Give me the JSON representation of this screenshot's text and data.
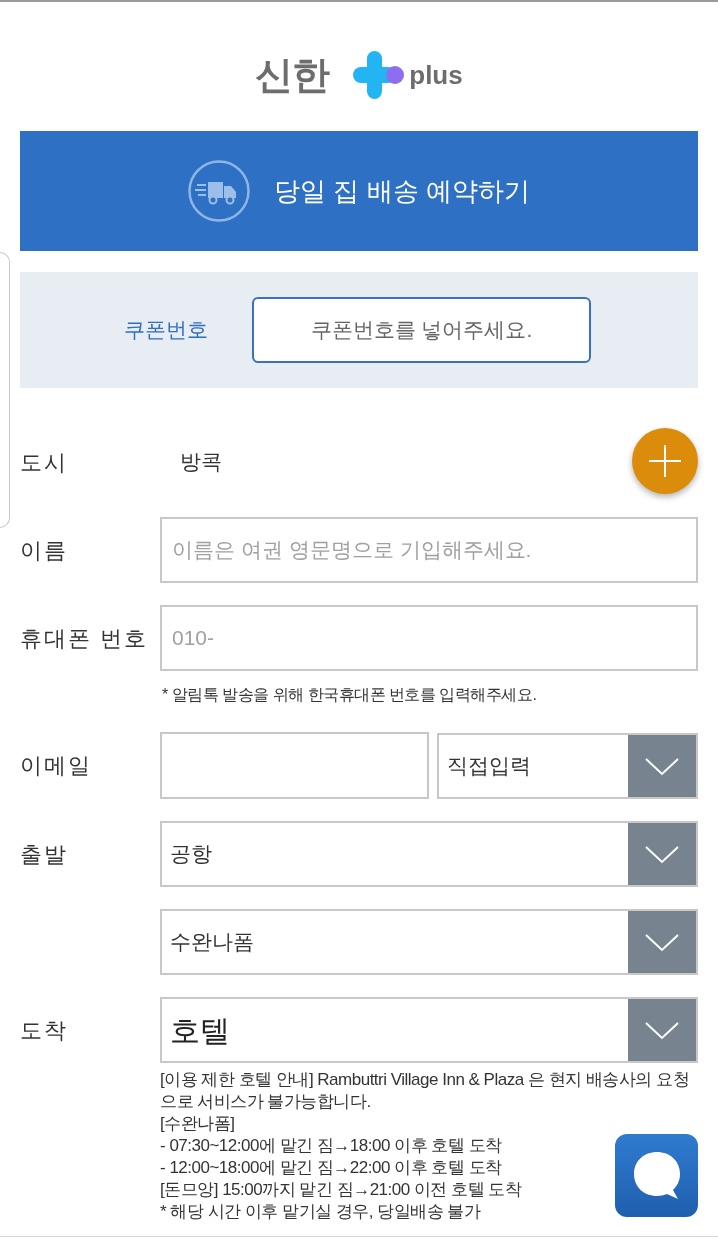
{
  "logo": {
    "name": "신한",
    "suffix": "plus"
  },
  "banner": {
    "title": "당일 집 배송 예약하기"
  },
  "coupon": {
    "label": "쿠폰번호",
    "placeholder": "쿠폰번호를 넣어주세요."
  },
  "rows": [
    {
      "kind": "static",
      "label": "도시",
      "value": "방콕"
    },
    {
      "kind": "input",
      "label": "이름",
      "placeholder": "이름은 여권 영문명으로 기입해주세요."
    },
    {
      "kind": "input",
      "label": "휴대폰 번호",
      "placeholder": "010-",
      "note": "* 알림톡 발송을 위해 한국휴대폰 번호를 입력해주세요."
    },
    {
      "kind": "email",
      "label": "이메일",
      "domain": "직접입력"
    },
    {
      "kind": "select",
      "label": "출발",
      "value": "공항",
      "large": false
    },
    {
      "kind": "select",
      "value": "수완나폼",
      "large": false
    },
    {
      "kind": "select",
      "label": "도착",
      "value": "호텔",
      "large": true
    }
  ],
  "notice": [
    "[이용 제한 호텔 안내] Rambuttri Village Inn & Plaza 은 현지 배송사의 요청으로 서비스가 불가능합니다.",
    "[수완나폼]",
    "- 07:30~12:00에 맡긴 짐→18:00 이후 호텔 도착",
    "- 12:00~18:00에 맡긴 짐→22:00 이후 호텔 도착",
    "[돈므앙] 15:00까지 맡긴 짐→21:00 이전 호텔 도착",
    "* 해당 시간 이후 맡기실 경우, 당일배송 불가"
  ]
}
